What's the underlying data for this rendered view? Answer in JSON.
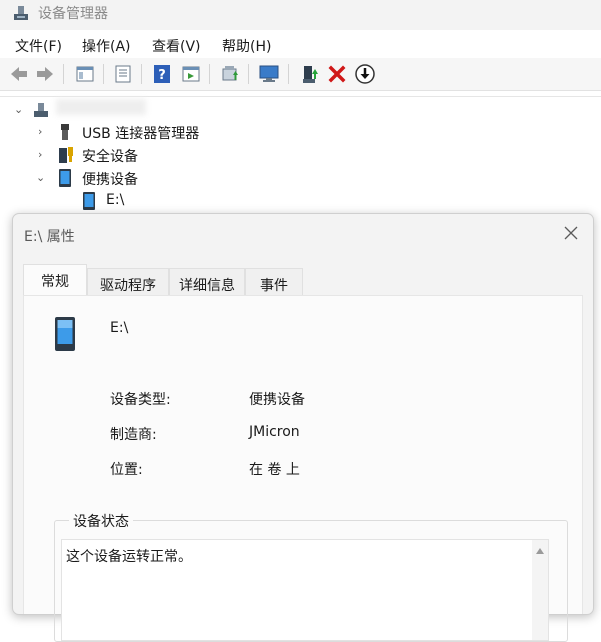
{
  "window": {
    "title": "设备管理器"
  },
  "menu": {
    "items": [
      "文件(F)",
      "操作(A)",
      "查看(V)",
      "帮助(H)"
    ]
  },
  "toolbar": {
    "icons": [
      "back-arrow-icon",
      "forward-arrow-icon",
      "view-icon",
      "properties-icon",
      "help-icon",
      "details-icon",
      "update-driver-icon",
      "monitor-scan-icon",
      "enable-device-icon",
      "uninstall-x-icon",
      "download-circle-icon"
    ]
  },
  "tree": {
    "root_label": "",
    "items": [
      {
        "label": "USB 连接器管理器",
        "state": "collapsed"
      },
      {
        "label": "安全设备",
        "state": "collapsed"
      },
      {
        "label": "便携设备",
        "state": "expanded"
      },
      {
        "label": "E:\\",
        "state": "child"
      }
    ]
  },
  "dialog": {
    "title": "E:\\ 属性",
    "tabs": [
      "常规",
      "驱动程序",
      "详细信息",
      "事件"
    ],
    "active_tab": "常规",
    "device_name": "E:\\",
    "properties": [
      {
        "label": "设备类型:",
        "value": "便携设备"
      },
      {
        "label": "制造商:",
        "value": "JMicron"
      },
      {
        "label": "位置:",
        "value": "在 卷 上"
      }
    ],
    "status": {
      "title": "设备状态",
      "text": "这个设备运转正常。"
    }
  }
}
